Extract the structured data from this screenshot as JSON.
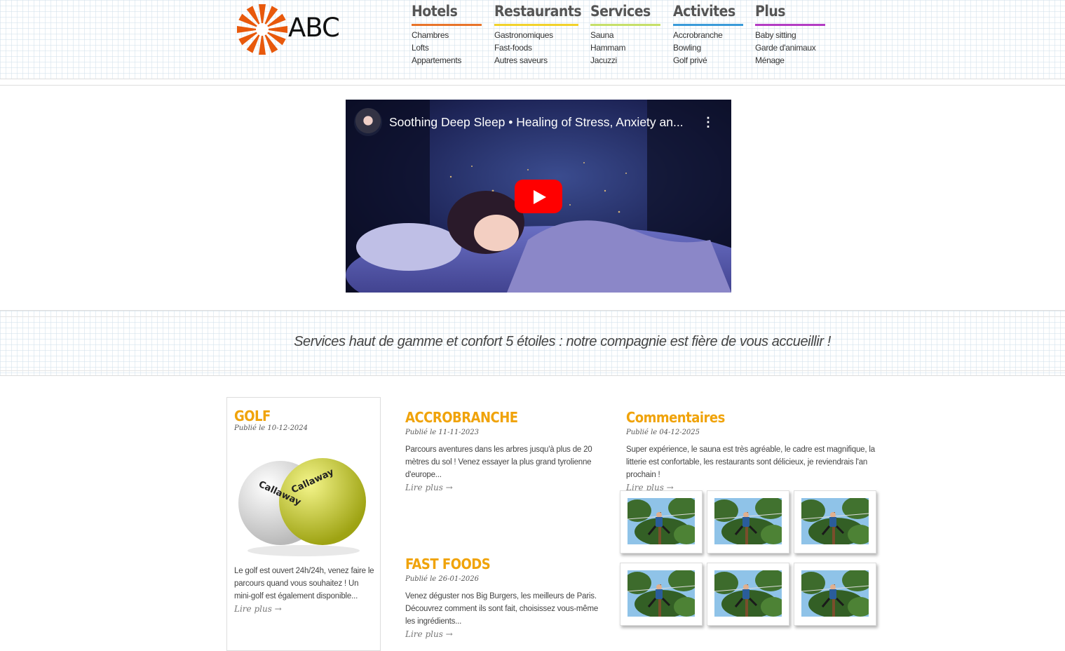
{
  "brand": {
    "name": "ABC",
    "logo_color": "#e8590c"
  },
  "nav": [
    {
      "label": "Hotels",
      "color": "#e8742a",
      "items": [
        "Chambres",
        "Lofts",
        "Appartements"
      ]
    },
    {
      "label": "Restaurants",
      "color": "#f2d22b",
      "items": [
        "Gastronomiques",
        "Fast-foods",
        "Autres saveurs"
      ]
    },
    {
      "label": "Services",
      "color": "#c6e06a",
      "items": [
        "Sauna",
        "Hammam",
        "Jacuzzi"
      ]
    },
    {
      "label": "Activites",
      "color": "#3a9bd9",
      "items": [
        "Accrobranche",
        "Bowling",
        "Golf privé"
      ]
    },
    {
      "label": "Plus",
      "color": "#b33cc4",
      "items": [
        "Baby sitting",
        "Garde d'animaux",
        "Ménage"
      ]
    }
  ],
  "video": {
    "title": "Soothing Deep Sleep • Healing of Stress, Anxiety an...",
    "play_icon": "play-icon",
    "play_color": "#ff0000"
  },
  "tagline": "Services haut de gamme et confort 5 étoiles : notre compagnie est fière de vous accueillir !",
  "articles": {
    "golf": {
      "title": "GOLF",
      "date": "Publié le 10-12-2024",
      "text": "Le golf est ouvert 24h/24h, venez faire le parcours quand vous souhaitez ! Un mini-golf est également disponible...",
      "read_more": "Lire plus →",
      "ball_brand": "Callaway"
    },
    "accro": {
      "title": "ACCROBRANCHE",
      "date": "Publié le 11-11-2023",
      "text": "Parcours aventures dans les arbres jusqu'à plus de 20 mètres du sol ! Venez essayer la plus grand tyrolienne d'europe...",
      "read_more": "Lire plus →"
    },
    "fastfood": {
      "title": "FAST FOODS",
      "date": "Publié le 26-01-2026",
      "text": "Venez déguster nos Big Burgers, les meilleurs de Paris. Découvrez comment ils sont fait, choisissez vous-même les ingrédients...",
      "read_more": "Lire plus →"
    },
    "comments": {
      "title": "Commentaires",
      "date": "Publié le 04-12-2025",
      "text": "Super expérience, le sauna est très agréable, le cadre est magnifique, la litterie est confortable, les restaurants sont délicieux, je reviendrais l'an prochain !",
      "read_more": "Lire plus →"
    }
  },
  "accent_color": "#f0a30a"
}
